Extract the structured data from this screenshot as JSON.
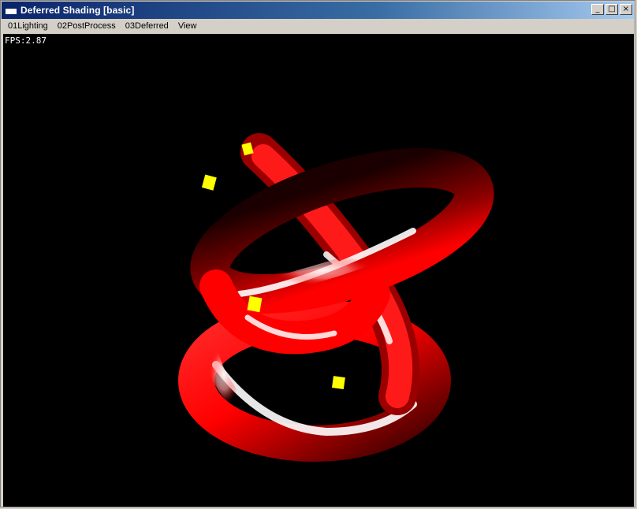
{
  "window": {
    "title": "Deferred Shading [basic]",
    "icon": "app-window-icon",
    "buttons": {
      "minimize": "_",
      "maximize": "□",
      "close": "×"
    }
  },
  "menu": {
    "items": [
      "01Lighting",
      "02PostProcess",
      "03Deferred",
      "View"
    ]
  },
  "viewport": {
    "fps_text": "FPS:2.87",
    "background": "#000000",
    "object_color": "#ff0000",
    "light_color": "#ffff00"
  }
}
